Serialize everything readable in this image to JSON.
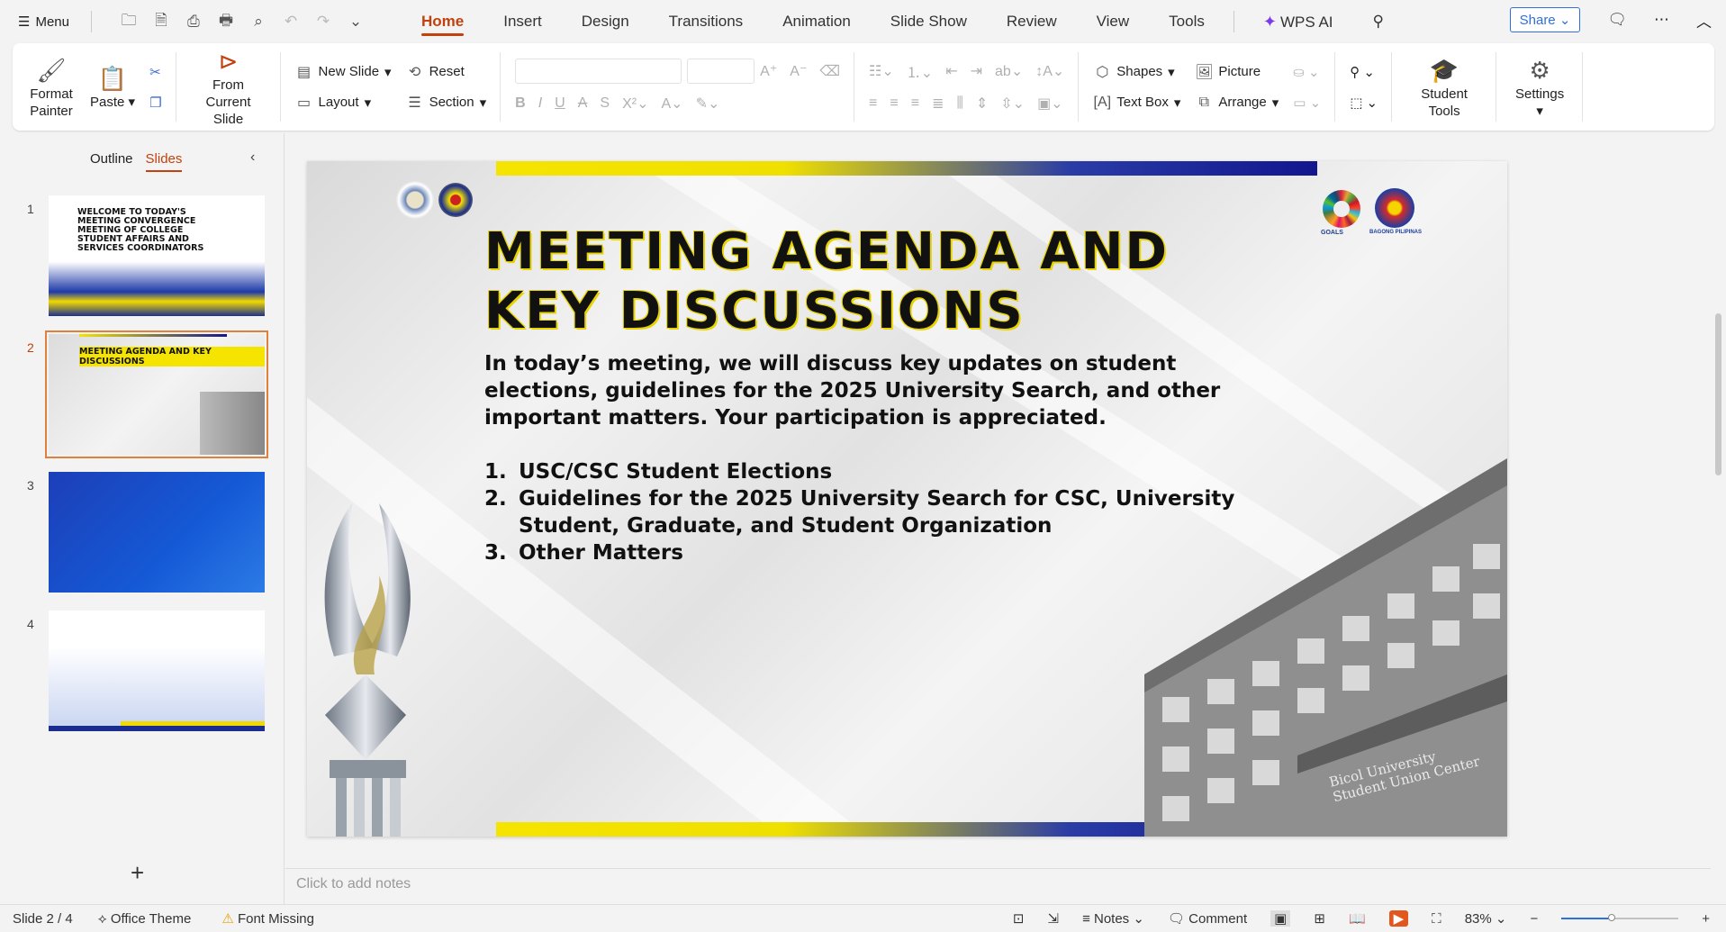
{
  "topbar": {
    "menu_label": "Menu",
    "tabs": [
      "Home",
      "Insert",
      "Design",
      "Transitions",
      "Animation",
      "Slide Show",
      "Review",
      "View",
      "Tools"
    ],
    "wps_ai": "WPS AI",
    "share": "Share"
  },
  "ribbon": {
    "format_painter": "Format Painter",
    "paste": "Paste",
    "from_current_slide": "From Current Slide",
    "new_slide": "New Slide",
    "reset": "Reset",
    "layout": "Layout",
    "section": "Section",
    "shapes": "Shapes",
    "picture": "Picture",
    "text_box": "Text Box",
    "arrange": "Arrange",
    "student_tools": "Student Tools",
    "settings": "Settings"
  },
  "panel": {
    "tab_outline": "Outline",
    "tab_slides": "Slides",
    "thumbs": [
      {
        "num": "1",
        "title": "WELCOME TO TODAY'S MEETING CONVERGENCE MEETING OF COLLEGE STUDENT AFFAIRS AND SERVICES COORDINATORS"
      },
      {
        "num": "2",
        "title": "MEETING AGENDA AND KEY DISCUSSIONS"
      },
      {
        "num": "3",
        "title": ""
      },
      {
        "num": "4",
        "title": ""
      }
    ]
  },
  "slide": {
    "title_line1": "MEETING AGENDA AND",
    "title_line2": "KEY DISCUSSIONS",
    "intro": "In today’s meeting, we will discuss key updates on student elections, guidelines for the 2025 University Search, and other important matters. Your participation is appreciated.",
    "items": [
      {
        "num": "1.",
        "text": "USC/CSC Student Elections"
      },
      {
        "num": "2.",
        "text": "Guidelines for the 2025 University Search for CSC, University Student, Graduate, and Student Organization"
      },
      {
        "num": "3.",
        "text": "Other Matters"
      }
    ],
    "building_sign": "Bicol University Student Union Center",
    "logo_goals": "GOALS",
    "logo_bagong": "BAGONG PILIPINAS"
  },
  "notes_placeholder": "Click to add notes",
  "status": {
    "slide_counter": "Slide 2 / 4",
    "theme": "Office Theme",
    "font_missing": "Font Missing",
    "notes": "Notes",
    "comment": "Comment",
    "zoom": "83%"
  },
  "colors": {
    "accent": "#c2410c",
    "band_yellow": "#f5e400",
    "band_blue": "#12168e",
    "share_blue": "#2f6fde"
  }
}
